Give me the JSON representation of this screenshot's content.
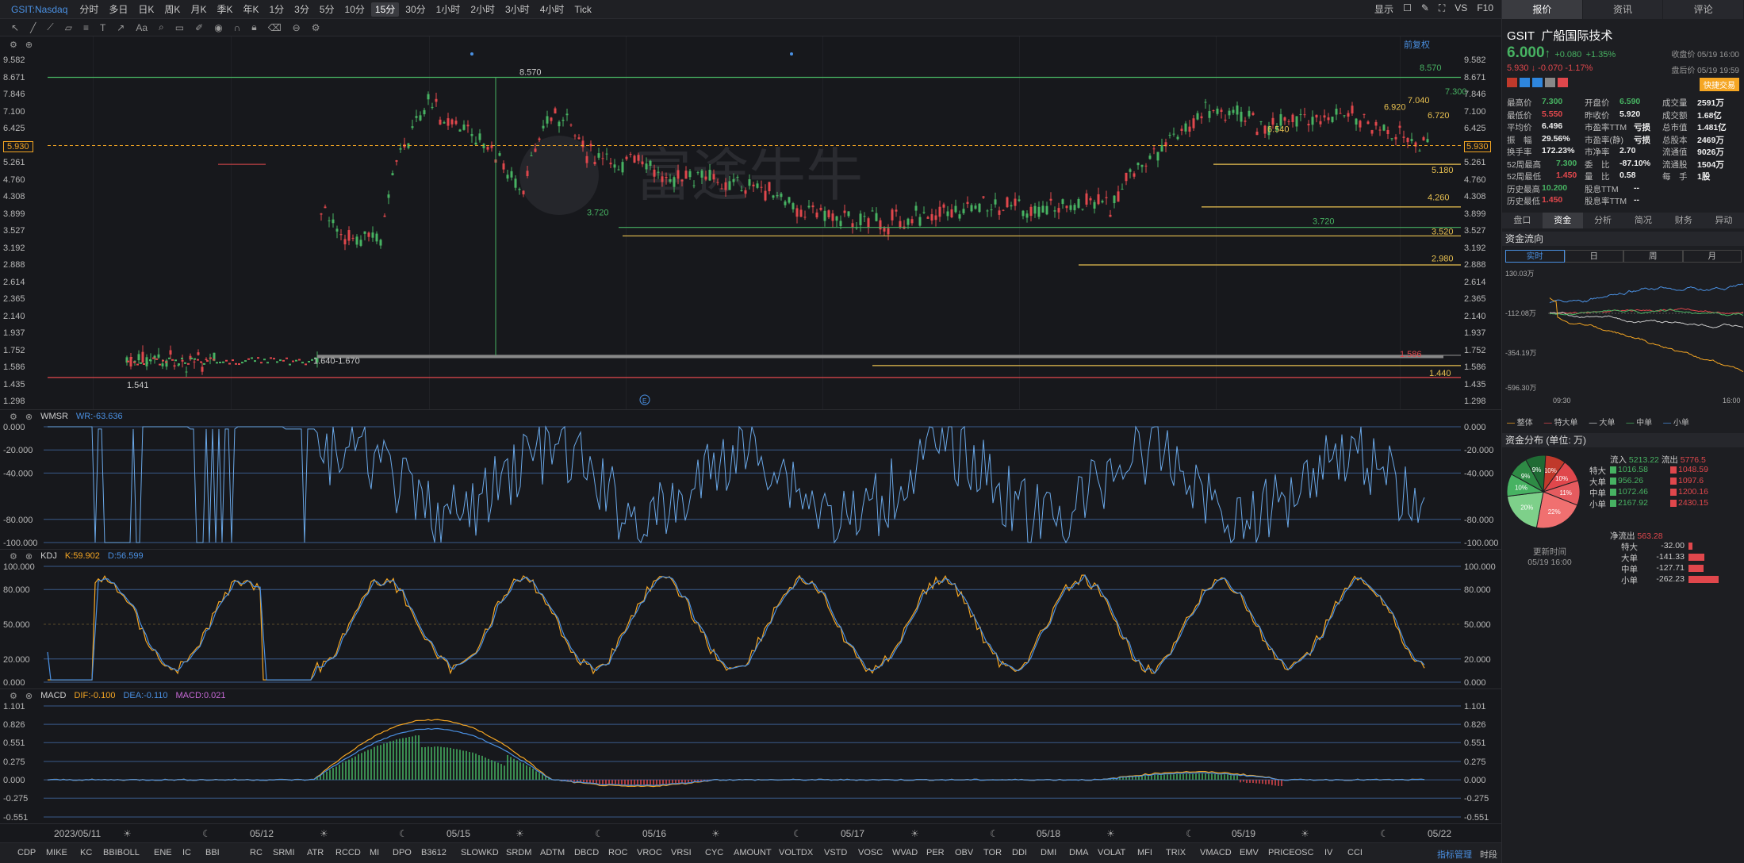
{
  "toolbar": {
    "symbol": "GSIT:Nasdaq",
    "intervals": [
      "分时",
      "多日",
      "日K",
      "周K",
      "月K",
      "季K",
      "年K",
      "1分",
      "3分",
      "5分",
      "10分",
      "15分",
      "30分",
      "1小时",
      "2小时",
      "3小时",
      "4小时",
      "Tick"
    ],
    "selected_interval": "15分",
    "right_items": [
      "显示",
      "VS",
      "F10"
    ]
  },
  "main_chart": {
    "adj_label": "前复权",
    "y_ticks": [
      "9.582",
      "8.671",
      "7.846",
      "7.100",
      "6.425",
      "5.930",
      "5.261",
      "4.760",
      "4.308",
      "3.899",
      "3.527",
      "3.192",
      "2.888",
      "2.614",
      "2.365",
      "2.140",
      "1.937",
      "1.752",
      "1.586",
      "1.435",
      "1.298"
    ],
    "current_price_tag": "5.930",
    "left_price_tag": "5.930",
    "annotations": [
      "8.570",
      "8.570",
      "7.300",
      "7.040",
      "6.920",
      "6.720",
      "6.540",
      "5.180",
      "4.260",
      "3.720",
      "3.720",
      "3.520",
      "2.980",
      "1.640-1.670",
      "1.541",
      "1.440",
      "1.586"
    ],
    "watermark": "富途牛牛",
    "marker_e": "E"
  },
  "wmsr": {
    "name": "WMSR",
    "value_label": "WR:-63.636",
    "y_ticks": [
      "0.000",
      "-20.000",
      "-40.000",
      "-80.000",
      "-100.000"
    ]
  },
  "kdj": {
    "name": "KDJ",
    "k_label": "K:59.902",
    "d_label": "D:56.599",
    "y_ticks": [
      "100.000",
      "80.000",
      "50.000",
      "20.000",
      "0.000"
    ]
  },
  "macd": {
    "name": "MACD",
    "dif_label": "DIF:-0.100",
    "dea_label": "DEA:-0.110",
    "macd_label": "MACD:0.021",
    "y_ticks": [
      "1.101",
      "0.826",
      "0.551",
      "0.275",
      "0.000",
      "-0.275",
      "-0.551"
    ]
  },
  "x_axis": [
    "2023/05/11",
    "05/12",
    "05/15",
    "05/16",
    "05/17",
    "05/18",
    "05/19",
    "05/22"
  ],
  "indicator_bar": [
    "CDP",
    "MIKE",
    "KC",
    "BBIBOLL",
    "ENE",
    "IC",
    "BBI",
    "RC",
    "SRMI",
    "ATR",
    "RCCD",
    "MI",
    "DPO",
    "B3612",
    "SLOWKD",
    "SRDM",
    "ADTM",
    "DBCD",
    "ROC",
    "VROC",
    "VRSI",
    "CYC",
    "AMOUNT",
    "VOLTDX",
    "VSTD",
    "VOSC",
    "WVAD",
    "PER",
    "OBV",
    "TOR",
    "DDI",
    "DMI",
    "DMA",
    "VOLAT",
    "MFI",
    "TRIX",
    "VMACD",
    "EMV",
    "PRICEOSC",
    "IV",
    "CCI"
  ],
  "indicator_manage": "指标管理",
  "indicator_period": "时段",
  "right": {
    "tabs": [
      "报价",
      "资讯",
      "评论"
    ],
    "ticker": "GSIT",
    "company": "广船国际技术",
    "price": "6.000",
    "change": "+0.080",
    "change_pct": "+1.35%",
    "close_time": "收盘价 05/19 16:00",
    "after_price": "5.930",
    "after_change": "-0.070",
    "after_pct": "-1.17%",
    "after_time": "盘后价 05/19 19:59",
    "quick_trade": "快捷交易",
    "stats": [
      [
        "最高价",
        "7.300",
        "开盘价",
        "6.590",
        "成交量",
        "2591万"
      ],
      [
        "最低价",
        "5.550",
        "昨收价",
        "5.920",
        "成交额",
        "1.68亿"
      ],
      [
        "平均价",
        "6.496",
        "市盈率TTM",
        "亏损",
        "总市值",
        "1.481亿"
      ],
      [
        "振　幅",
        "29.56%",
        "市盈率(静)",
        "亏损",
        "总股本",
        "2469万"
      ],
      [
        "换手率",
        "172.23%",
        "市净率",
        "2.70",
        "流通值",
        "9026万"
      ],
      [
        "52周最高",
        "7.300",
        "委　比",
        "-87.10%",
        "流通股",
        "1504万"
      ],
      [
        "52周最低",
        "1.450",
        "量　比",
        "0.58",
        "每　手",
        "1股"
      ],
      [
        "历史最高",
        "10.200",
        "股息TTM",
        "--",
        "",
        ""
      ],
      [
        "历史最低",
        "1.450",
        "股息率TTM",
        "--",
        "",
        ""
      ]
    ],
    "subtabs": [
      "盘口",
      "资金",
      "分析",
      "简况",
      "财务",
      "异动"
    ],
    "flow_header": "资金流向",
    "flow_tabs": [
      "实时",
      "日",
      "周",
      "月"
    ],
    "flow_y": [
      "130.03万",
      "-112.08万",
      "-354.19万",
      "-596.30万"
    ],
    "flow_x": [
      "09:30",
      "16:00"
    ],
    "flow_legend": [
      "整体",
      "特大单",
      "大单",
      "中单",
      "小单"
    ],
    "dist_header": "资金分布 (单位: 万)",
    "inflow_label": "流入",
    "inflow": "5213.22",
    "outflow_label": "流出",
    "outflow": "5776.5",
    "dist_rows": [
      [
        "特大",
        "1016.58",
        "1048.59"
      ],
      [
        "大单",
        "956.26",
        "1097.6"
      ],
      [
        "中单",
        "1072.46",
        "1200.16"
      ],
      [
        "小单",
        "2167.92",
        "2430.15"
      ]
    ],
    "pie_labels": [
      "10%",
      "10%",
      "11%",
      "22%",
      "20%",
      "10%",
      "9%",
      "9%"
    ],
    "net_label": "净流出",
    "net_value": "563.28",
    "update_label": "更新时间",
    "update_time": "05/19 16:00",
    "net_rows": [
      [
        "特大",
        "-32.00"
      ],
      [
        "大单",
        "-141.33"
      ],
      [
        "中单",
        "-127.71"
      ],
      [
        "小单",
        "-262.23"
      ]
    ]
  },
  "colors": {
    "up": "#47b262",
    "down": "#e0474c",
    "accent": "#4a90e2",
    "dif": "#f5a623",
    "dea": "#4a90e2",
    "macd": "#c86ad8"
  }
}
